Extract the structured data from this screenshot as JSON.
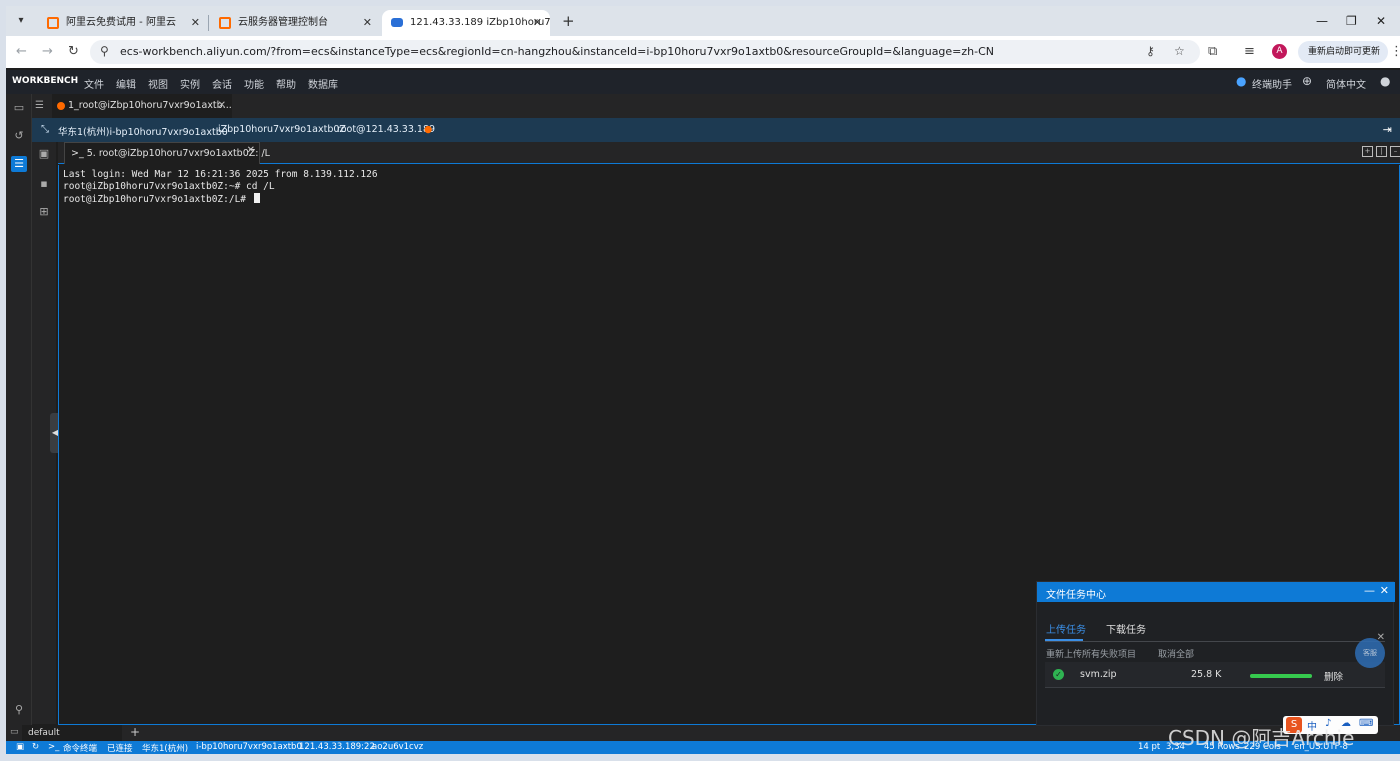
{
  "browser": {
    "tabs": [
      {
        "title": "阿里云免费试用 - 阿里云"
      },
      {
        "title": "云服务器管理控制台"
      },
      {
        "title": "121.43.33.189 iZbp10horu7v..."
      }
    ],
    "url": "ecs-workbench.aliyun.com/?from=ecs&instanceType=ecs&regionId=cn-hangzhou&instanceId=i-bp10horu7vxr9o1axtb0&resourceGroupId=&language=zh-CN",
    "profile_initial": "A",
    "update_button": "重新启动即可更新"
  },
  "menubar": {
    "brand": "WORKBENCH",
    "items": [
      "文件",
      "编辑",
      "视图",
      "实例",
      "会话",
      "功能",
      "帮助",
      "数据库"
    ],
    "assistant": "终端助手",
    "language": "简体中文"
  },
  "session_tab": {
    "label": "1_root@iZbp10horu7vxr9o1axtb..."
  },
  "infobar": {
    "region_instance": "华东1(杭州)i-bp10horu7vxr9o1axtb0",
    "hostname": "iZbp10horu7vxr9o1axtb0Z",
    "login": "root@121.43.33.189"
  },
  "terminal_tab": {
    "label": ">_ 5. root@iZbp10horu7vxr9o1axtb0Z: /L"
  },
  "terminal": {
    "lines": [
      "Last login: Wed Mar 12 16:21:36 2025 from 8.139.112.126",
      "root@iZbp10horu7vxr9o1axtb0Z:~# cd /L",
      "root@iZbp10horu7vxr9o1axtb0Z:/L# "
    ]
  },
  "bottom": {
    "tab_label": "default"
  },
  "statusbar": {
    "left": [
      "命令终端",
      "已连接",
      "华东1(杭州)",
      "i-bp10horu7vxr9o1axtb0",
      "121.43.33.189:22",
      "ao2u6v1cvz"
    ],
    "right": [
      "14 pt",
      "3,34",
      "45 Rows",
      "229 Cols",
      "en_US.UTF-8"
    ]
  },
  "file_task_center": {
    "title": "文件任务中心",
    "tabs": [
      "上传任务",
      "下载任务"
    ],
    "actions": [
      "重新上传所有失败项目",
      "取消全部"
    ],
    "files": [
      {
        "name": "svm.zip",
        "size": "25.8 K",
        "progress": 1.0,
        "action": "删除"
      }
    ],
    "bubble_text": "客服"
  },
  "watermark": "CSDN @阿吉Archie",
  "ime": {
    "items": [
      "中",
      "♪",
      "☁",
      "⌨"
    ]
  },
  "colors": {
    "accent": "#0e7ad6",
    "brand": "#ff6a00",
    "success": "#36c94e"
  }
}
